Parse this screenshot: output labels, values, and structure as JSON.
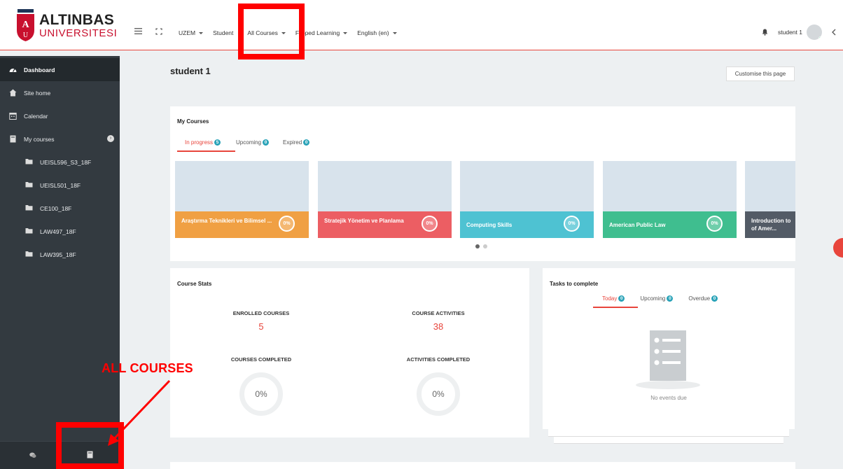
{
  "brand": {
    "name": "ALTINBAS",
    "sub": "UNIVERSITESI",
    "colors": {
      "accent": "#e8453c",
      "brand": "#c8102e"
    }
  },
  "nav": {
    "items": [
      {
        "label": "UZEM",
        "dropdown": true
      },
      {
        "label": "Student",
        "dropdown": false
      },
      {
        "label": "All Courses",
        "dropdown": true
      },
      {
        "label": "Flipped Learning",
        "dropdown": true
      },
      {
        "label": "English (en)",
        "dropdown": true
      }
    ],
    "user": "student 1"
  },
  "sidebar": {
    "items": [
      {
        "label": "Dashboard",
        "icon": "dashboard-icon"
      },
      {
        "label": "Site home",
        "icon": "home-icon"
      },
      {
        "label": "Calendar",
        "icon": "calendar-icon"
      },
      {
        "label": "My courses",
        "icon": "courses-icon"
      },
      {
        "label": "UEISL596_S3_18F",
        "icon": "folder-icon"
      },
      {
        "label": "UEISL501_18F",
        "icon": "folder-icon"
      },
      {
        "label": "CE100_18F",
        "icon": "folder-icon"
      },
      {
        "label": "LAW497_18F",
        "icon": "folder-icon"
      },
      {
        "label": "LAW395_18F",
        "icon": "folder-icon"
      }
    ]
  },
  "page": {
    "title": "student 1",
    "customise": "Customise this page"
  },
  "my_courses": {
    "title": "My Courses",
    "tabs": [
      {
        "label": "In progress",
        "count": "5"
      },
      {
        "label": "Upcoming",
        "count": "0"
      },
      {
        "label": "Expired",
        "count": "0"
      }
    ],
    "courses": [
      {
        "name": "Araştırma Teknikleri ve Bilimsel ...",
        "progress": "0%",
        "color": "#f0a043"
      },
      {
        "name": "Stratejik Yönetim ve Planlama",
        "progress": "0%",
        "color": "#ec5e63"
      },
      {
        "name": "Computing Skills",
        "progress": "0%",
        "color": "#4ec2d2"
      },
      {
        "name": "American Public Law",
        "progress": "0%",
        "color": "#3fbe8f"
      },
      {
        "name": "Introduction to the Study of Amer...",
        "progress": "",
        "color": "#535b66"
      }
    ]
  },
  "course_stats": {
    "title": "Course Stats",
    "enrolled_label": "ENROLLED COURSES",
    "enrolled": "5",
    "activities_label": "COURSE ACTIVITIES",
    "activities": "38",
    "completed_label": "COURSES COMPLETED",
    "completed": "0%",
    "activities_completed_label": "ACTIVITIES COMPLETED",
    "activities_completed": "0%"
  },
  "tasks": {
    "title": "Tasks to complete",
    "tabs": [
      {
        "label": "Today",
        "count": "0"
      },
      {
        "label": "Upcoming",
        "count": "0"
      },
      {
        "label": "Overdue",
        "count": "0"
      }
    ],
    "empty": "No events due"
  },
  "annotation": {
    "label": "ALL COURSES",
    "color": "#ff0000"
  }
}
